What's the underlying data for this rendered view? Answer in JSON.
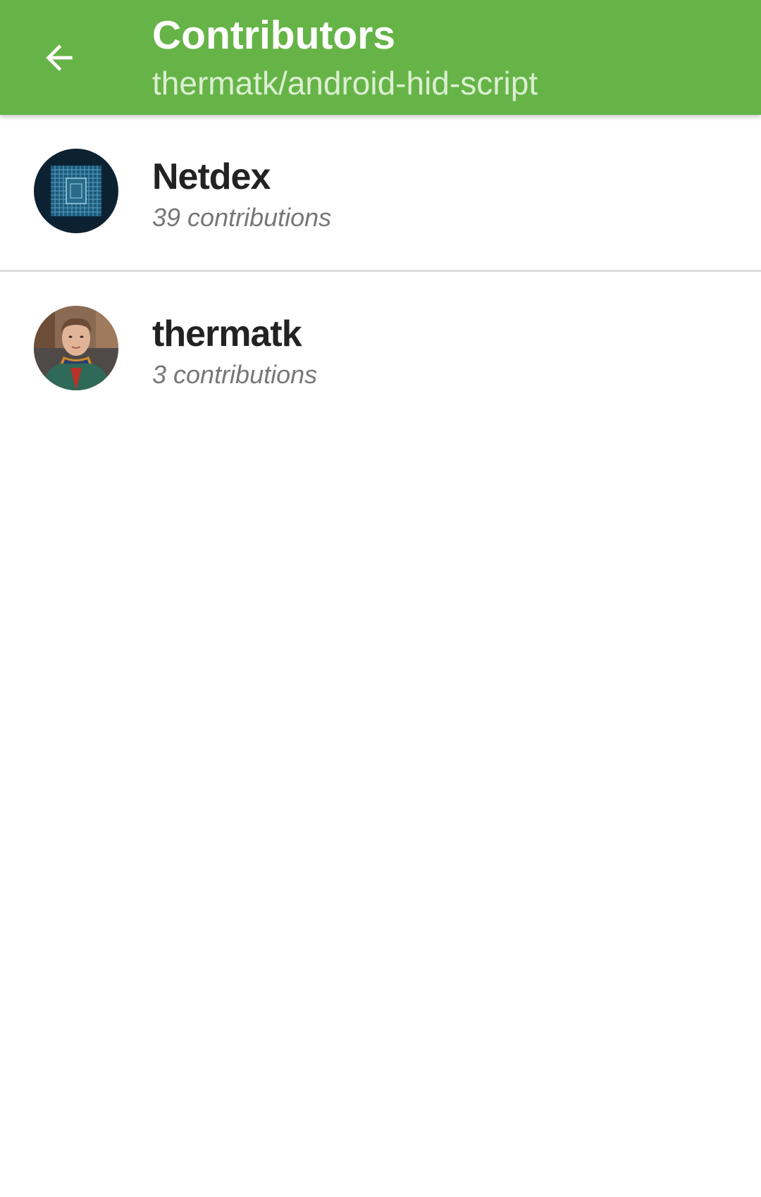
{
  "app_bar": {
    "title": "Contributors",
    "subtitle": "thermatk/android-hid-script",
    "back_icon": "arrow-back-icon",
    "color": "#66b447"
  },
  "contributors": [
    {
      "name": "Netdex",
      "contributions": "39 contributions",
      "avatar": "cpu-chip-avatar"
    },
    {
      "name": "thermatk",
      "contributions": "3 contributions",
      "avatar": "person-photo-avatar"
    }
  ]
}
